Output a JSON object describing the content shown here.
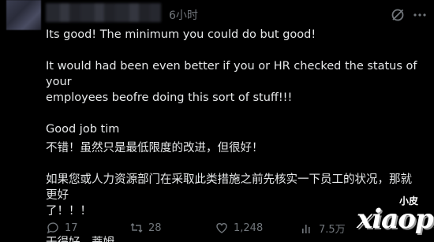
{
  "post": {
    "time": "6小时",
    "lines": [
      "Its good! The minimum you could do but good!",
      "It would had been even better if you or HR checked the status of your",
      "employees beofre doing this sort of stuff!!!",
      "Good job tim",
      "不错！虽然只是最低限度的改进，但很好！",
      "如果您或人力资源部门在采取此类措施之前先核实一下员工的状况，那就更好",
      "了！！！",
      "干得好，蒂姆"
    ]
  },
  "actions": {
    "reply_count": "17",
    "repost_count": "28",
    "like_count": "1,248",
    "views_count": "7.5万"
  },
  "icons": {
    "grok": "grok-icon",
    "more": "more-icon",
    "reply": "reply-icon",
    "repost": "repost-icon",
    "like": "like-icon",
    "views": "views-icon"
  },
  "watermark": {
    "small": "小皮",
    "big": "xiaopi"
  }
}
